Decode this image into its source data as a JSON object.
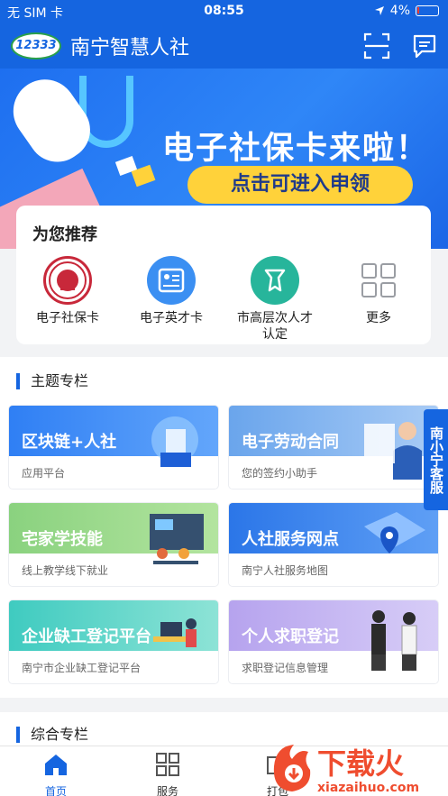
{
  "status_bar": {
    "carrier": "无 SIM 卡",
    "time": "08:55",
    "battery": "4%"
  },
  "header": {
    "logo_text": "12333",
    "title": "南宁智慧人社"
  },
  "banner": {
    "headline": "电子社保卡来啦！",
    "cta": "点击可进入申领"
  },
  "recommend": {
    "title": "为您推荐",
    "items": [
      {
        "label": "电子社保卡",
        "icon": "social-security-card-icon"
      },
      {
        "label": "电子英才卡",
        "icon": "id-card-icon"
      },
      {
        "label": "市高层次人才\n认定",
        "icon": "talent-certification-icon"
      },
      {
        "label": "更多",
        "icon": "more-grid-icon"
      }
    ]
  },
  "topics": {
    "title": "主题专栏",
    "tiles": [
      {
        "name": "区块链+人社",
        "sub": "应用平台",
        "color": "#2d7df3"
      },
      {
        "name": "电子劳动合同",
        "sub": "您的签约小助手",
        "color": "#7fb3ef"
      },
      {
        "name": "宅家学技能",
        "sub": "线上教学线下就业",
        "color": "#8fd48a"
      },
      {
        "name": "人社服务网点",
        "sub": "南宁人社服务地图",
        "color": "#2e7bea"
      },
      {
        "name": "企业缺工登记平台",
        "sub": "南宁市企业缺工登记平台",
        "color": "#4fd0c2"
      },
      {
        "name": "个人求职登记",
        "sub": "求职登记信息管理",
        "color": "#c6b6f2"
      }
    ]
  },
  "float_tag": "南小宁客服",
  "comprehensive": {
    "title": "综合专栏"
  },
  "tabbar": {
    "items": [
      {
        "label": "首页",
        "icon": "home-icon"
      },
      {
        "label": "服务",
        "icon": "grid-icon"
      },
      {
        "label": "打包",
        "icon": "box-icon"
      }
    ]
  },
  "watermark": {
    "cn": "下载火",
    "en": "xiazaihuo.com"
  },
  "colors": {
    "primary": "#1565e0",
    "banner_cta": "#ffd23a"
  }
}
